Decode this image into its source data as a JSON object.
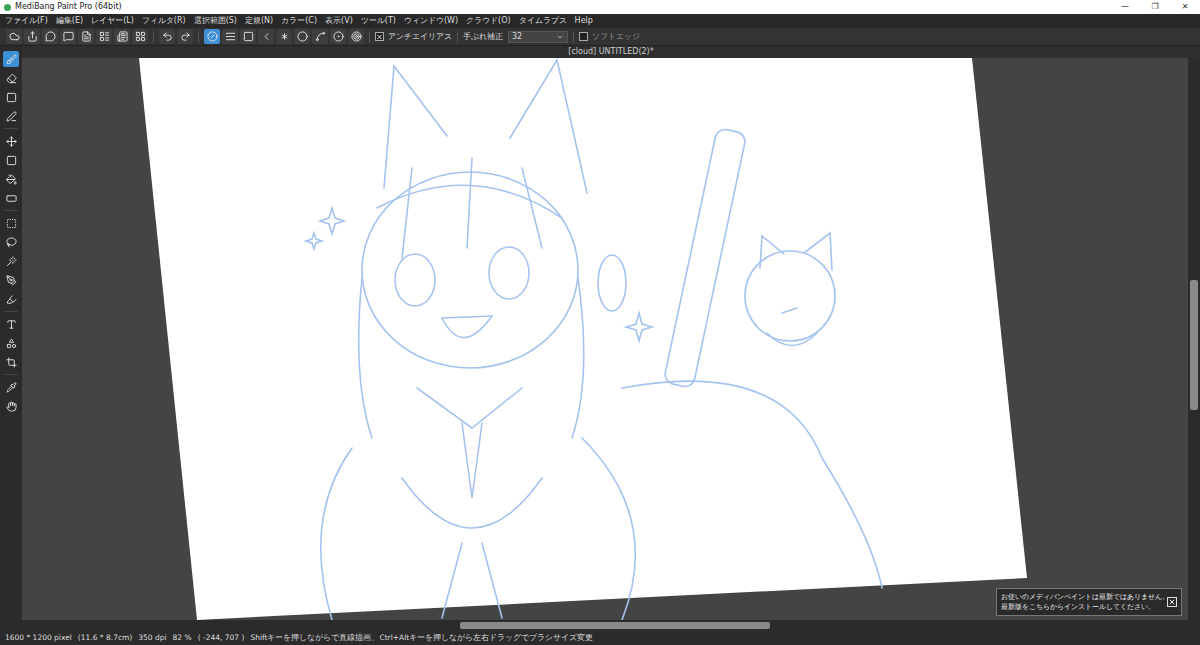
{
  "window": {
    "title": "MediBang Paint Pro (64bit)",
    "controls": [
      "—",
      "❐",
      "✕"
    ]
  },
  "menu": [
    "ファイル(F)",
    "編集(E)",
    "レイヤー(L)",
    "フィルタ(R)",
    "選択範囲(S)",
    "定規(N)",
    "カラー(C)",
    "表示(V)",
    "ツール(T)",
    "ウィンドウ(W)",
    "クラウド(O)",
    "タイムラプス",
    "Help"
  ],
  "toolbar": {
    "buttons": [
      {
        "selected": false
      },
      {
        "selected": false
      },
      {
        "selected": false
      },
      {
        "selected": false
      },
      {
        "selected": false
      },
      {
        "selected": false
      },
      {
        "selected": false
      },
      {
        "selected": false
      },
      {
        "selected": false
      },
      {
        "selected": false
      },
      {
        "selected": true
      },
      {
        "selected": false
      },
      {
        "selected": false
      },
      {
        "selected": false
      },
      {
        "selected": false
      },
      {
        "selected": false
      },
      {
        "selected": false
      },
      {
        "selected": false
      },
      {
        "selected": false
      }
    ],
    "antialias": {
      "label": "アンチエイリアス",
      "checked": true
    },
    "stabilizer": {
      "label": "手ぶれ補正",
      "value": "32"
    },
    "soft_edge": {
      "label": "ソフトエッジ",
      "checked": false
    }
  },
  "document_tab": {
    "title": "[cloud] UNTITLED(2)*"
  },
  "tools": [
    {
      "selected": true
    },
    {
      "selected": false
    },
    {
      "selected": false
    },
    {
      "selected": false
    },
    {
      "selected": false
    },
    {
      "selected": false
    },
    {
      "selected": false
    },
    {
      "selected": false
    },
    {
      "selected": false
    },
    {
      "selected": false
    },
    {
      "selected": false
    },
    {
      "selected": false
    },
    {
      "selected": false
    },
    {
      "selected": false
    },
    {
      "selected": false
    },
    {
      "selected": false
    },
    {
      "selected": false
    },
    {
      "selected": false
    }
  ],
  "notification": {
    "lines": [
      "お使いのメディバンペイントは最新ではありません。",
      "最新版をこちらからインストールしてください。"
    ]
  },
  "status_bar": [
    "1600 * 1200 pixel",
    "(11.6 * 8.7cm)",
    "350 dpi",
    "82 %",
    "( -244, 707 )",
    "Shiftキーを押しながらで直線描画、Ctrl+Altキーを押しながら左右ドラッグでブラシサイズ変更"
  ]
}
